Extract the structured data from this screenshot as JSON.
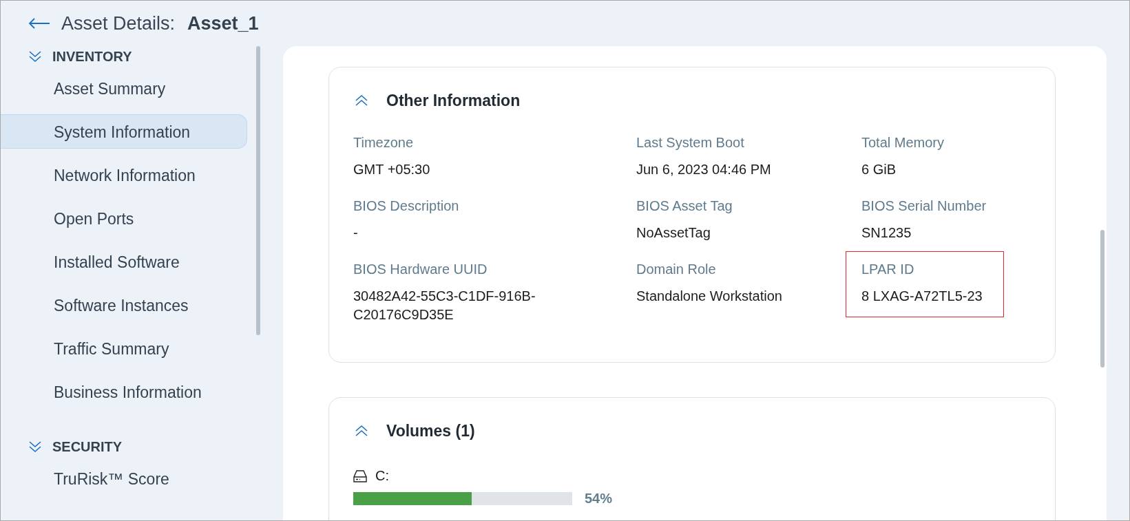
{
  "header": {
    "title": "Asset Details:",
    "asset_name": "Asset_1"
  },
  "sidebar": {
    "sections": [
      {
        "title": "INVENTORY",
        "expanded": true,
        "items": [
          {
            "label": "Asset Summary",
            "selected": false
          },
          {
            "label": "System Information",
            "selected": true
          },
          {
            "label": "Network Information",
            "selected": false
          },
          {
            "label": "Open Ports",
            "selected": false
          },
          {
            "label": "Installed Software",
            "selected": false
          },
          {
            "label": "Software Instances",
            "selected": false
          },
          {
            "label": "Traffic Summary",
            "selected": false
          },
          {
            "label": "Business Information",
            "selected": false
          }
        ]
      },
      {
        "title": "SECURITY",
        "expanded": true,
        "items": [
          {
            "label": "TruRisk™ Score",
            "selected": false
          }
        ]
      }
    ]
  },
  "cards": [
    {
      "kind": "fields",
      "title": "Other Information",
      "expanded": true,
      "fields": [
        {
          "label": "Timezone",
          "value": "GMT +05:30",
          "highlighted": false
        },
        {
          "label": "Last System Boot",
          "value": "Jun 6, 2023 04:46 PM",
          "highlighted": false
        },
        {
          "label": "Total Memory",
          "value": "6 GiB",
          "highlighted": false
        },
        {
          "label": "BIOS Description",
          "value": "-",
          "highlighted": false
        },
        {
          "label": "BIOS Asset Tag",
          "value": "NoAssetTag",
          "highlighted": false
        },
        {
          "label": "BIOS Serial Number",
          "value": "SN1235",
          "highlighted": false
        },
        {
          "label": "BIOS Hardware UUID",
          "value": "30482A42-55C3-C1DF-916B-C20176C9D35E",
          "highlighted": false
        },
        {
          "label": "Domain Role",
          "value": "Standalone Workstation",
          "highlighted": false
        },
        {
          "label": "LPAR ID",
          "value": "8 LXAG-A72TL5-23",
          "highlighted": true
        }
      ]
    },
    {
      "kind": "volumes",
      "title": "Volumes (1)",
      "expanded": true,
      "volumes": [
        {
          "name": "C:",
          "level": 0.54,
          "reading": "54%"
        }
      ]
    }
  ]
}
